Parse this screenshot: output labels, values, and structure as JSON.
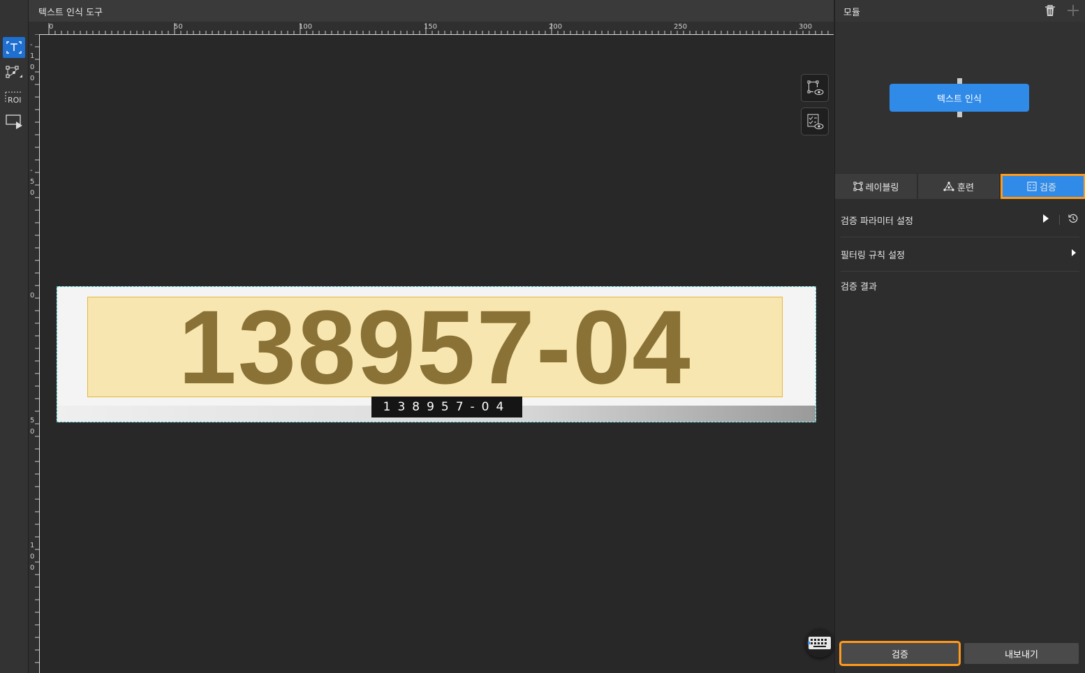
{
  "app": {
    "title": "텍스트 인식 도구"
  },
  "toolbar": {
    "tools": [
      {
        "name": "text-tool",
        "active": true
      },
      {
        "name": "polygon-tool",
        "active": false
      },
      {
        "name": "roi-tool",
        "label": "ROI",
        "active": false
      },
      {
        "name": "image-play-tool",
        "active": false
      }
    ]
  },
  "ruler": {
    "top_labels": [
      "0",
      "50",
      "100",
      "150",
      "200",
      "250",
      "300"
    ],
    "left_labels": [
      "-",
      "1",
      "0",
      "0",
      "-",
      "5",
      "0",
      "0",
      "5",
      "0",
      "1",
      "0",
      "0"
    ]
  },
  "canvas": {
    "ocr_text": "138957-04",
    "result_text": "138957-04"
  },
  "module_panel": {
    "title": "모듈",
    "node_label": "텍스트 인식"
  },
  "tabs": [
    {
      "label": "레이블링",
      "icon": "labeling-icon",
      "active": false
    },
    {
      "label": "훈련",
      "icon": "training-icon",
      "active": false
    },
    {
      "label": "검증",
      "icon": "validation-icon",
      "active": true
    }
  ],
  "sections": {
    "validation_params": "검증 파라미터 설정",
    "filter_rules": "필터링 규칙 설정",
    "validation_result": "검증 결과"
  },
  "buttons": {
    "validate": "검증",
    "export": "내보내기"
  },
  "colors": {
    "accent": "#2f8ae8",
    "highlight": "#ff9a1c",
    "roi_fill": "#fcda78"
  }
}
